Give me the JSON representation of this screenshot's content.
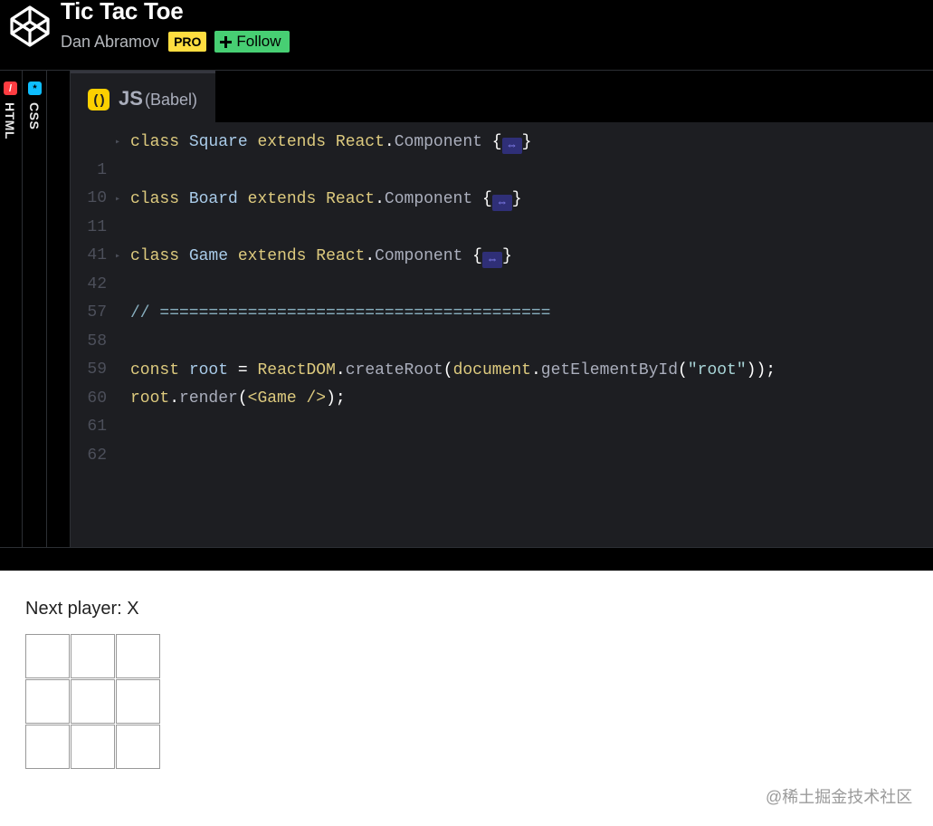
{
  "header": {
    "title": "Tic Tac Toe",
    "author": "Dan Abramov",
    "pro_badge": "PRO",
    "follow_label": "Follow"
  },
  "editor": {
    "side_tabs": [
      {
        "label": "HTML",
        "icon": "html-icon",
        "color": "#ff3c41"
      },
      {
        "label": "CSS",
        "icon": "css-icon",
        "color": "#0ebeff"
      }
    ],
    "js_tab": {
      "label": "JS",
      "sub": "(Babel)",
      "icon": "js-icon",
      "color": "#fcd000"
    },
    "lines": [
      {
        "number": "1",
        "folded": true,
        "tokens": [
          "class",
          "Square",
          "extends",
          "React",
          ".",
          "Component",
          "{",
          "}"
        ]
      },
      {
        "number": "10"
      },
      {
        "number": "11",
        "folded": true,
        "tokens": [
          "class",
          "Board",
          "extends",
          "React",
          ".",
          "Component",
          "{",
          "}"
        ]
      },
      {
        "number": "41"
      },
      {
        "number": "42",
        "folded": true,
        "tokens": [
          "class",
          "Game",
          "extends",
          "React",
          ".",
          "Component",
          "{",
          "}"
        ]
      },
      {
        "number": "57"
      },
      {
        "number": "58",
        "text": "// ========================================"
      },
      {
        "number": "59"
      },
      {
        "number": "60",
        "tokens": [
          "const",
          "root",
          "=",
          "ReactDOM",
          ".",
          "createRoot",
          "(",
          "document",
          ".",
          "getElementById",
          "(",
          "\"root\"",
          "));"
        ]
      },
      {
        "number": "61",
        "tokens": [
          "root",
          ".",
          "render",
          "(",
          "<Game />",
          ");"
        ]
      },
      {
        "number": "62"
      }
    ]
  },
  "preview": {
    "status": "Next player: X",
    "squares": [
      "",
      "",
      "",
      "",
      "",
      "",
      "",
      "",
      ""
    ]
  },
  "watermark": "@稀土掘金技术社区",
  "colors": {
    "header_bg": "#000000",
    "editor_bg": "#1d1e22",
    "pro_badge": "#ffdd40",
    "follow_button": "#47cf73"
  }
}
